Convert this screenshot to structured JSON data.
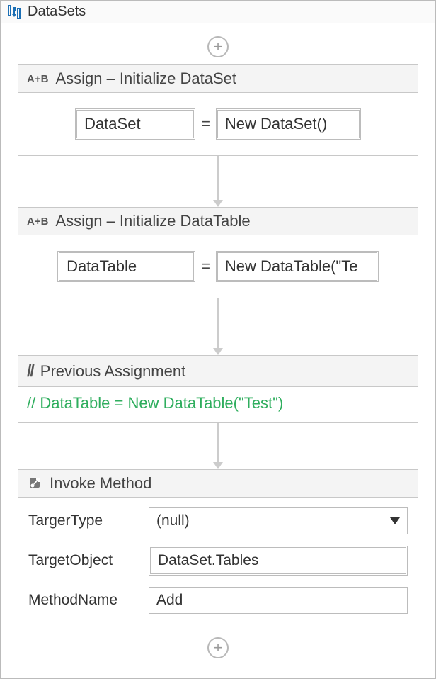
{
  "sequence": {
    "title": "DataSets"
  },
  "assign1": {
    "title": "Assign – Initialize DataSet",
    "left": "DataSet",
    "right": "New DataSet()"
  },
  "assign2": {
    "title": "Assign – Initialize DataTable",
    "left": "DataTable",
    "right": "New DataTable(\"Te"
  },
  "comment": {
    "title": "Previous Assignment",
    "body": "// DataTable = New DataTable(\"Test\")"
  },
  "invoke": {
    "title": "Invoke Method",
    "fields": {
      "targetTypeLabel": "TargerType",
      "targetTypeValue": "(null)",
      "targetObjectLabel": "TargetObject",
      "targetObjectValue": "DataSet.Tables",
      "methodNameLabel": "MethodName",
      "methodNameValue": "Add"
    }
  },
  "glyphs": {
    "plus": "+",
    "ab": "A+B",
    "slashes": "//",
    "equals": "="
  }
}
